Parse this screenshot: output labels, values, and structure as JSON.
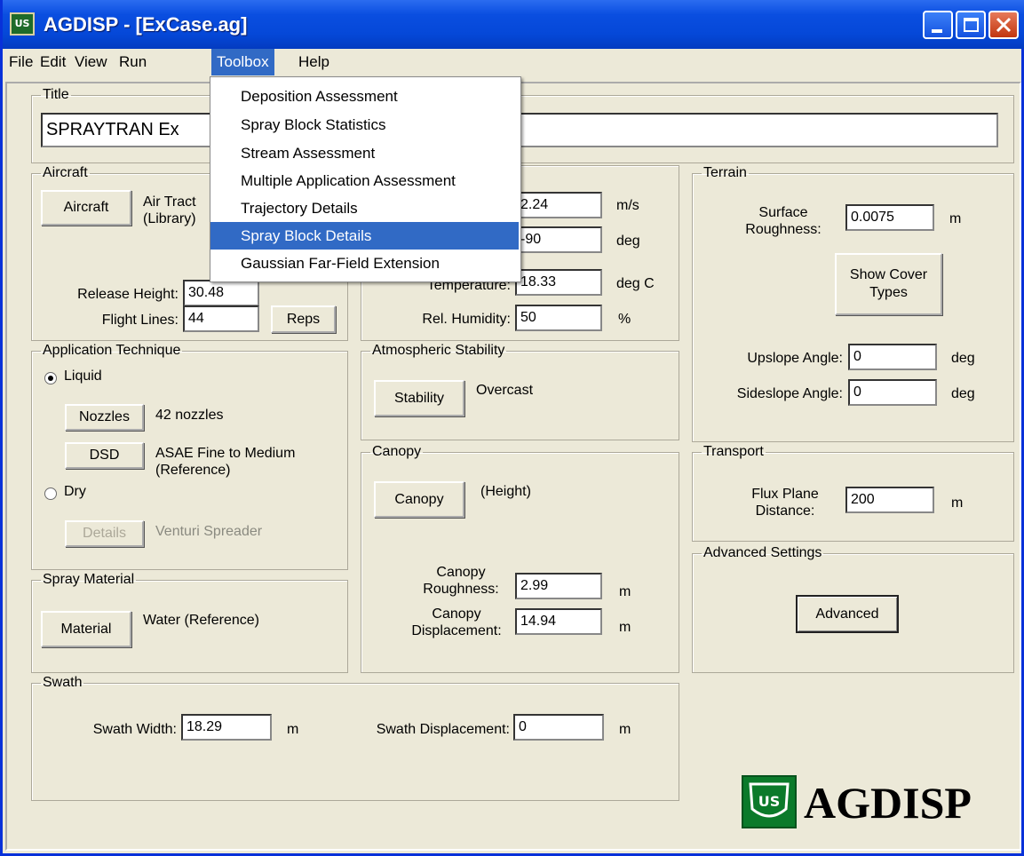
{
  "window": {
    "title": "AGDISP - [ExCase.ag]",
    "icon_name": "agdisp-app-icon",
    "title_bar_color": "#0a4ee0",
    "controls": [
      "minimize-icon",
      "maximize-icon",
      "close-icon"
    ]
  },
  "menu": {
    "items": [
      "File",
      "Edit",
      "View",
      "Run",
      "Toolbox",
      "Help"
    ],
    "active": "Toolbox",
    "toolbox_items": [
      "Deposition Assessment",
      "Spray Block Statistics",
      "Stream Assessment",
      "Multiple Application Assessment",
      "Trajectory Details",
      "Spray Block Details",
      "Gaussian Far-Field Extension"
    ],
    "selected_item": "Spray Block Details",
    "highlight_color": "#316ac5"
  },
  "title_group": {
    "label": "Title",
    "value": "SPRAYTRAN Ex"
  },
  "aircraft": {
    "label": "Aircraft",
    "button": "Aircraft",
    "name_line1": "Air Tract",
    "name_line2": "(Library)",
    "release_height_label": "Release Height:",
    "release_height_value": "30.48",
    "flight_lines_label": "Flight Lines:",
    "flight_lines_value": "44",
    "reps_button": "Reps"
  },
  "meteorology": {
    "wind_speed_value": "2.24",
    "wind_speed_unit": "m/s",
    "wind_direction_value": "-90",
    "wind_direction_unit": "deg",
    "temperature_label": "Temperature:",
    "temperature_value": "18.33",
    "temperature_unit": "deg C",
    "humidity_label": "Rel. Humidity:",
    "humidity_value": "50",
    "humidity_unit": "%"
  },
  "terrain": {
    "label": "Terrain",
    "surface_roughness_label_1": "Surface",
    "surface_roughness_label_2": "Roughness:",
    "surface_roughness_value": "0.0075",
    "surface_roughness_unit": "m",
    "cover_button_1": "Show Cover",
    "cover_button_2": "Types",
    "upslope_label": "Upslope Angle:",
    "upslope_value": "0",
    "upslope_unit": "deg",
    "sideslope_label": "Sideslope Angle:",
    "sideslope_value": "0",
    "sideslope_unit": "deg"
  },
  "application": {
    "label": "Application Technique",
    "liquid_label": "Liquid",
    "liquid_selected": true,
    "nozzles_button": "Nozzles",
    "nozzles_value": "42 nozzles",
    "dsd_button": "DSD",
    "dsd_line1": "ASAE Fine to Medium",
    "dsd_line2": "(Reference)",
    "dry_label": "Dry",
    "details_button": "Details",
    "details_value": "Venturi Spreader"
  },
  "stability": {
    "label": "Atmospheric Stability",
    "button": "Stability",
    "value": "Overcast"
  },
  "canopy": {
    "label": "Canopy",
    "button": "Canopy",
    "value": "(Height)",
    "roughness_label_1": "Canopy",
    "roughness_label_2": "Roughness:",
    "roughness_value": "2.99",
    "roughness_unit": "m",
    "displacement_label_1": "Canopy",
    "displacement_label_2": "Displacement:",
    "displacement_value": "14.94",
    "displacement_unit": "m"
  },
  "transport": {
    "label": "Transport",
    "flux_label_1": "Flux Plane",
    "flux_label_2": "Distance:",
    "flux_value": "200",
    "flux_unit": "m"
  },
  "advanced": {
    "label": "Advanced Settings",
    "button": "Advanced"
  },
  "spray_material": {
    "label": "Spray Material",
    "button": "Material",
    "value": "Water (Reference)"
  },
  "swath": {
    "label": "Swath",
    "width_label": "Swath Width:",
    "width_value": "18.29",
    "width_unit": "m",
    "displacement_label": "Swath Displacement:",
    "displacement_value": "0",
    "displacement_unit": "m"
  },
  "logo": {
    "text": "AGDISP",
    "shield_text": "US",
    "icon_name": "usfs-shield-icon",
    "color": "#0b7a2a"
  }
}
